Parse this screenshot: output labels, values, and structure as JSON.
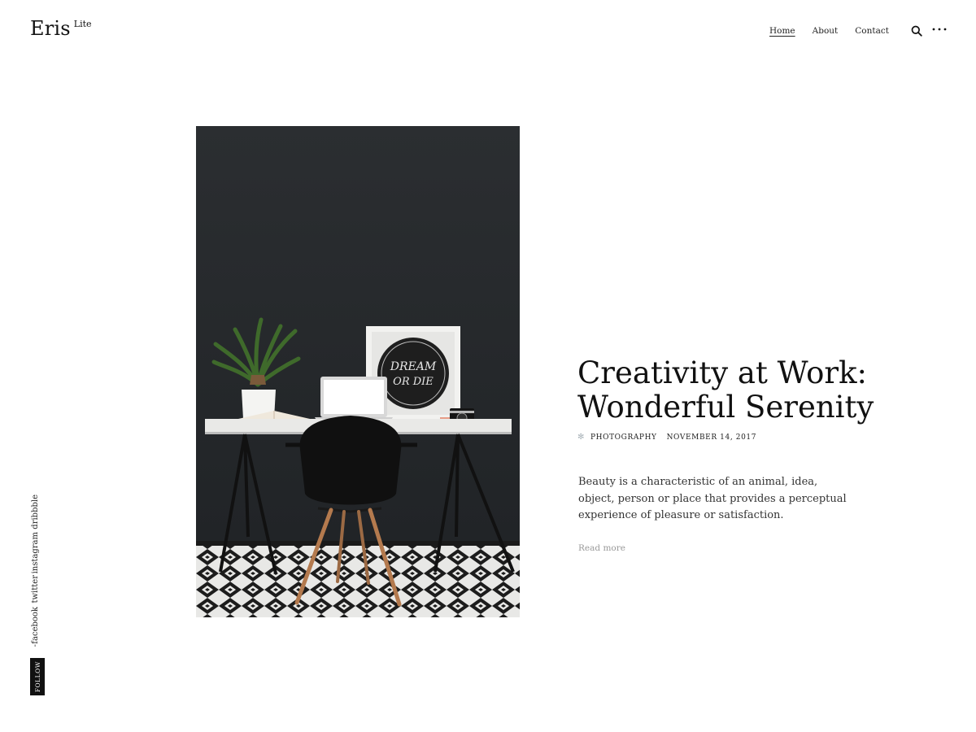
{
  "site": {
    "name": "Eris",
    "tagline": "Lite"
  },
  "nav": {
    "items": [
      "Home",
      "About",
      "Contact"
    ],
    "active": "Home"
  },
  "icons": {
    "search": "search-icon",
    "menu": "more-dots-icon"
  },
  "post": {
    "title_line1": "Creativity at Work:",
    "title_line2": "Wonderful Serenity",
    "category": "Photography",
    "date": "November 14, 2017",
    "excerpt": "Beauty is a characteristic of an animal, idea, object, person or place that provides a perceptual experience of pleasure or satisfaction.",
    "read_more": "Read more",
    "image": {
      "subject": "black desk setup with plant, laptop, framed poster, camera and chair",
      "poster_line1": "DREAM",
      "poster_line2": "OR DIE"
    }
  },
  "social": {
    "links": [
      "dribbble",
      "instagram",
      "twitter",
      "facebook"
    ],
    "separator": "-",
    "follow_label": "Follow"
  },
  "colors": {
    "text": "#111111",
    "muted": "#9a9a9a",
    "accent_star": "#aab4ba",
    "follow_bg": "#111111"
  }
}
